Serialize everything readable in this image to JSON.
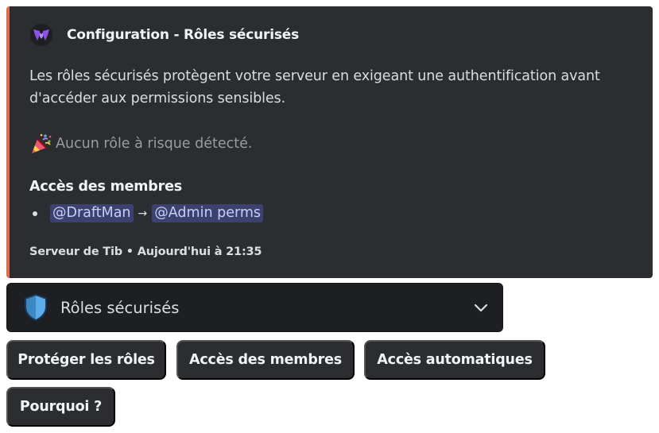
{
  "embed": {
    "accent_color": "#e06c4e",
    "author": {
      "icon": "shield-logo-icon",
      "name": "Configuration - Rôles sécurisés"
    },
    "description": "Les rôles sécurisés protègent votre serveur en exigeant une authentification avant d'accéder aux permissions sensibles.",
    "status": {
      "icon": "party-popper-icon",
      "text": "Aucun rôle à risque détecté."
    },
    "field": {
      "title": "Accès des membres",
      "items": [
        {
          "from": "@DraftMan",
          "arrow": "→",
          "to": "@Admin perms"
        }
      ]
    },
    "footer": "Serveur de Tib • Aujourd'hui à 21:35"
  },
  "select_menu": {
    "icon": "blue-shield-icon",
    "label": "Rôles sécurisés",
    "chevron": "chevron-down-icon"
  },
  "buttons": {
    "protect": "Protéger les rôles",
    "member_access": "Accès des membres",
    "auto_access": "Accès automatiques",
    "why": "Pourquoi ?"
  }
}
